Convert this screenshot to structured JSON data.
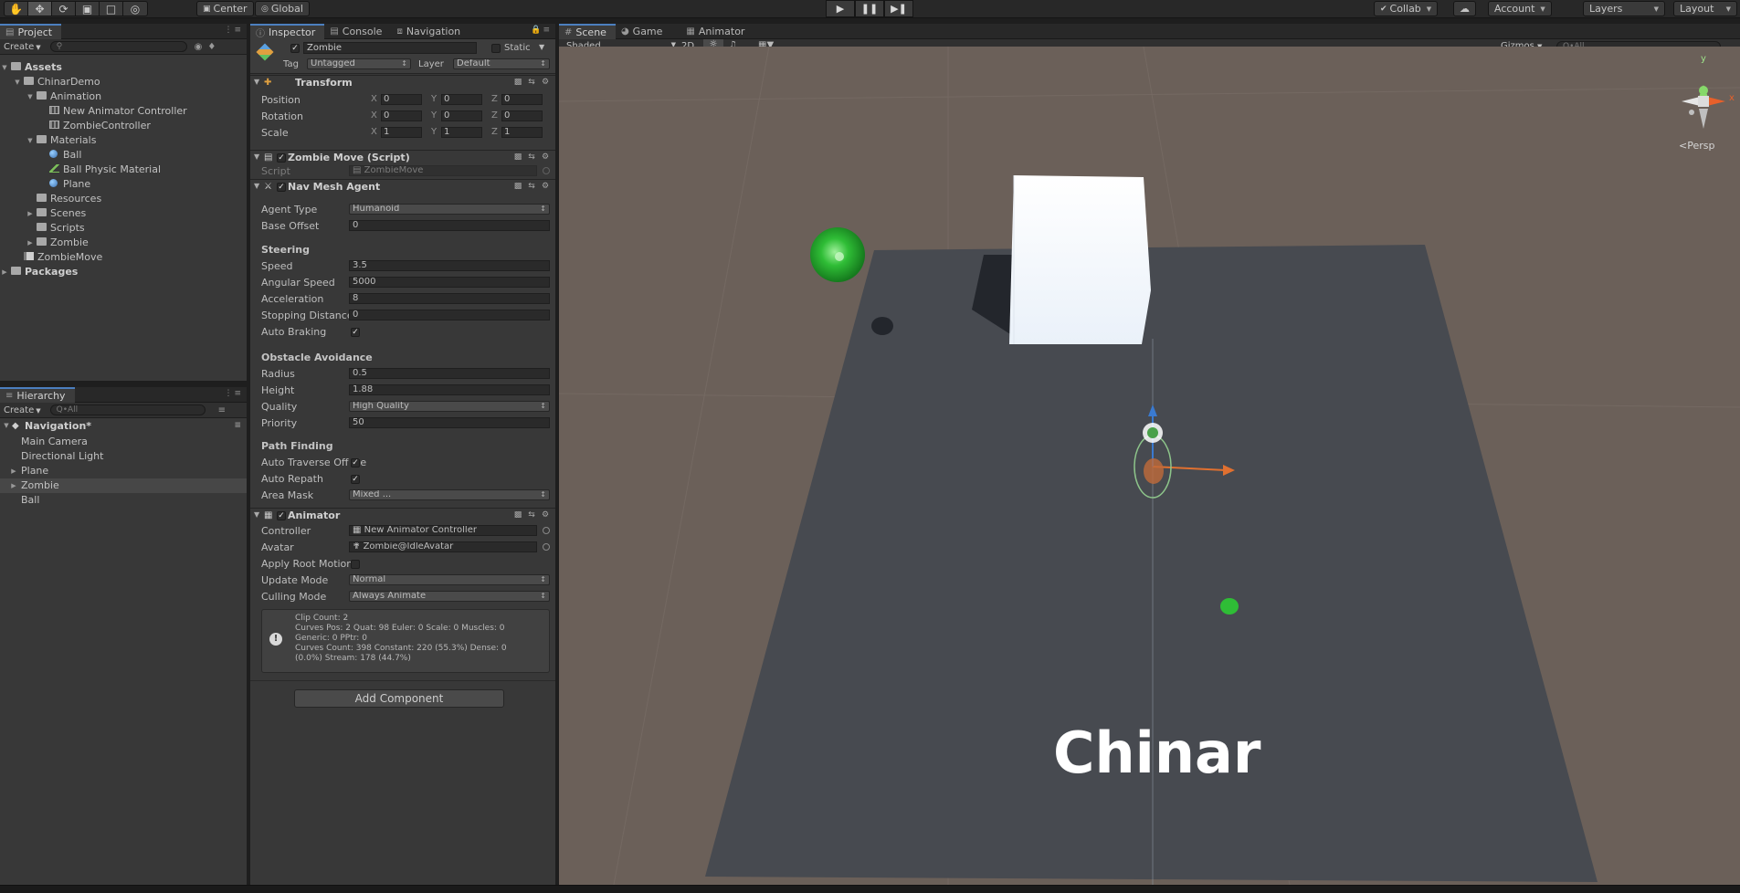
{
  "toolbar": {
    "pivot": "Center",
    "space": "Global",
    "collab": "Collab",
    "account": "Account",
    "layers": "Layers",
    "layout": "Layout",
    "tool_icons": [
      "hand-icon",
      "move-icon",
      "rotate-icon",
      "scale-icon",
      "rect-icon",
      "transform-icon"
    ],
    "play_icons": [
      "play-icon",
      "pause-icon",
      "step-icon"
    ]
  },
  "project": {
    "tab": "Project",
    "create": "Create",
    "items": [
      {
        "label": "Assets",
        "depth": 0,
        "arrow": "down",
        "icon": "folder",
        "bold": true
      },
      {
        "label": "ChinarDemo",
        "depth": 1,
        "arrow": "down",
        "icon": "folder"
      },
      {
        "label": "Animation",
        "depth": 2,
        "arrow": "down",
        "icon": "folder"
      },
      {
        "label": "New Animator Controller",
        "depth": 3,
        "arrow": "",
        "icon": "anim"
      },
      {
        "label": "ZombieController",
        "depth": 3,
        "arrow": "",
        "icon": "anim"
      },
      {
        "label": "Materials",
        "depth": 2,
        "arrow": "down",
        "icon": "folder"
      },
      {
        "label": "Ball",
        "depth": 3,
        "arrow": "",
        "icon": "sphere"
      },
      {
        "label": "Ball Physic Material",
        "depth": 3,
        "arrow": "",
        "icon": "physic"
      },
      {
        "label": "Plane",
        "depth": 3,
        "arrow": "",
        "icon": "sphere"
      },
      {
        "label": "Resources",
        "depth": 2,
        "arrow": "",
        "icon": "folder"
      },
      {
        "label": "Scenes",
        "depth": 2,
        "arrow": "right",
        "icon": "folder"
      },
      {
        "label": "Scripts",
        "depth": 2,
        "arrow": "",
        "icon": "folder"
      },
      {
        "label": "Zombie",
        "depth": 2,
        "arrow": "right",
        "icon": "folder"
      },
      {
        "label": "ZombieMove",
        "depth": 1,
        "arrow": "",
        "icon": "script"
      },
      {
        "label": "Packages",
        "depth": 0,
        "arrow": "right",
        "icon": "folder",
        "bold": true
      }
    ]
  },
  "hierarchy": {
    "tab": "Hierarchy",
    "create": "Create",
    "search_placeholder": "Q•All",
    "scene": "Navigation*",
    "items": [
      {
        "label": "Main Camera",
        "arrow": false,
        "selected": false
      },
      {
        "label": "Directional Light",
        "arrow": false,
        "selected": false
      },
      {
        "label": "Plane",
        "arrow": true,
        "selected": false
      },
      {
        "label": "Zombie",
        "arrow": true,
        "selected": true
      },
      {
        "label": "Ball",
        "arrow": false,
        "selected": false
      }
    ]
  },
  "inspector": {
    "tabs": [
      "Inspector",
      "Console",
      "Navigation"
    ],
    "object_name": "Zombie",
    "static_label": "Static",
    "tag_label": "Tag",
    "tag_value": "Untagged",
    "layer_label": "Layer",
    "layer_value": "Default",
    "transform": {
      "title": "Transform",
      "rows": [
        {
          "label": "Position",
          "x": "0",
          "y": "0",
          "z": "0"
        },
        {
          "label": "Rotation",
          "x": "0",
          "y": "0",
          "z": "0"
        },
        {
          "label": "Scale",
          "x": "1",
          "y": "1",
          "z": "1"
        }
      ],
      "axes": [
        "X",
        "Y",
        "Z"
      ]
    },
    "zombie_move": {
      "title": "Zombie Move (Script)",
      "script_label": "Script",
      "script_value": "ZombieMove"
    },
    "nav_mesh": {
      "title": "Nav Mesh Agent",
      "agent_type_label": "Agent Type",
      "agent_type": "Humanoid",
      "base_offset_label": "Base Offset",
      "base_offset": "0",
      "steering": "Steering",
      "speed_label": "Speed",
      "speed": "3.5",
      "angular_label": "Angular Speed",
      "angular": "5000",
      "accel_label": "Acceleration",
      "accel": "8",
      "stopping_label": "Stopping Distance",
      "stopping": "0",
      "braking_label": "Auto Braking",
      "obstacle": "Obstacle Avoidance",
      "radius_label": "Radius",
      "radius": "0.5",
      "height_label": "Height",
      "height": "1.88",
      "quality_label": "Quality",
      "quality": "High Quality",
      "priority_label": "Priority",
      "priority": "50",
      "path": "Path Finding",
      "traverse_label": "Auto Traverse Off Me",
      "repath_label": "Auto Repath",
      "area_label": "Area Mask",
      "area": "Mixed ..."
    },
    "animator": {
      "title": "Animator",
      "controller_label": "Controller",
      "controller": "New Animator Controller",
      "avatar_label": "Avatar",
      "avatar": "Zombie@IdleAvatar",
      "root_label": "Apply Root Motion",
      "update_label": "Update Mode",
      "update": "Normal",
      "culling_label": "Culling Mode",
      "culling": "Always Animate",
      "info": [
        "Clip Count: 2",
        "Curves Pos: 2 Quat: 98 Euler: 0 Scale: 0 Muscles: 0",
        "Generic: 0 PPtr: 0",
        "Curves Count: 398 Constant: 220 (55.3%) Dense: 0",
        "(0.0%) Stream: 178 (44.7%)"
      ]
    },
    "add_component": "Add Component"
  },
  "scene": {
    "tabs": [
      "Scene",
      "Game",
      "Animator"
    ],
    "shading": "Shaded",
    "mode_2d": "2D",
    "gizmos": "Gizmos",
    "search_placeholder": "Q•All",
    "persp": "<Persp",
    "watermark": "Chinar",
    "gizmo_axes": [
      "y",
      "x"
    ]
  },
  "colors": {
    "panel": "#383838",
    "scene_ground": "#6b6059",
    "plane": "#474a50",
    "selection": "#474747",
    "accent": "#4c7fbf"
  }
}
